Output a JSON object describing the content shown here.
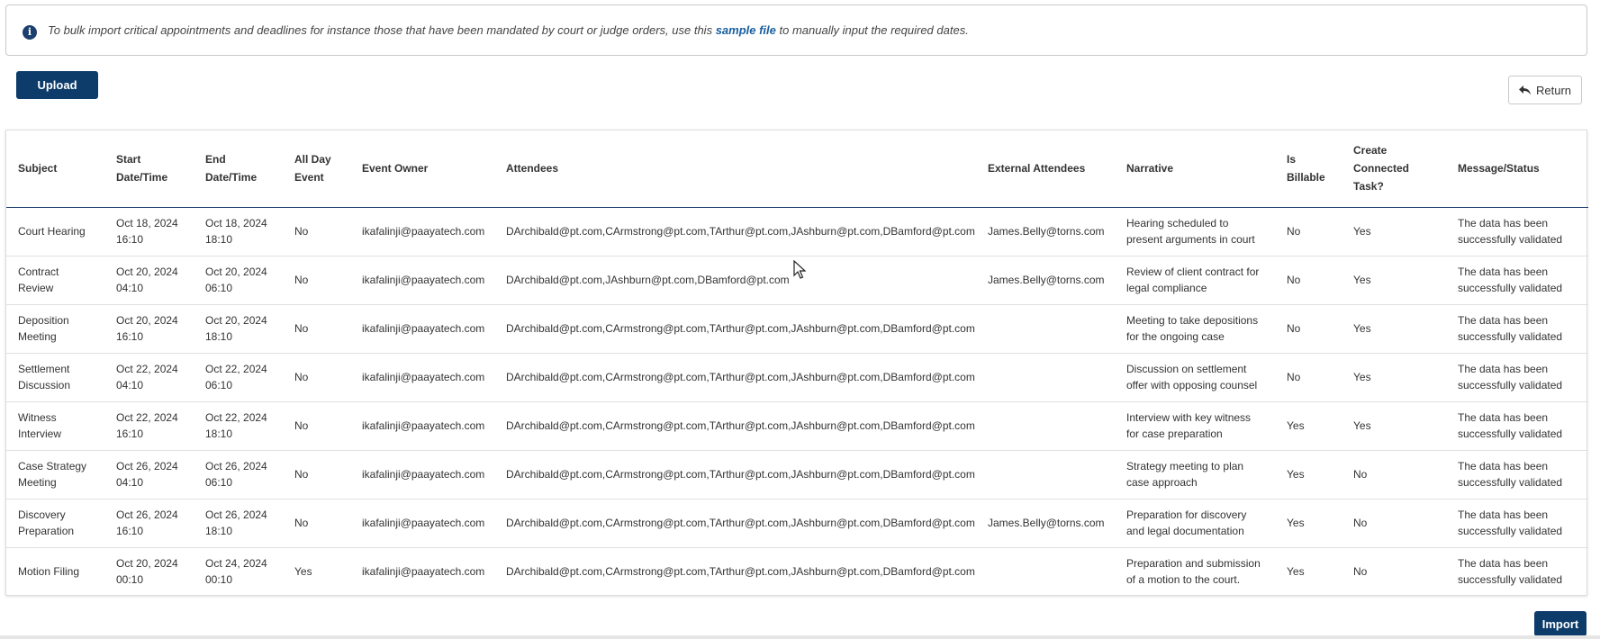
{
  "info": {
    "text_before": "To bulk import critical appointments and deadlines for instance those that have been mandated by court or judge orders, use this ",
    "link": "sample file",
    "text_after": " to manually input the required dates.",
    "icon": "info-icon"
  },
  "toolbar": {
    "upload_label": "Upload",
    "return_label": "Return",
    "return_icon": "reply-arrow-icon",
    "import_label": "Import"
  },
  "colors": {
    "primary": "#0d3c6b",
    "link": "#1a5fa0"
  },
  "table": {
    "headers": [
      [
        "Subject"
      ],
      [
        "Start",
        "Date/Time"
      ],
      [
        "End",
        "Date/Time"
      ],
      [
        "All Day",
        "Event"
      ],
      [
        "Event Owner"
      ],
      [
        "Attendees"
      ],
      [
        "External Attendees"
      ],
      [
        "Narrative"
      ],
      [
        "Is",
        "Billable"
      ],
      [
        "Create",
        "Connected",
        "Task?"
      ],
      [
        "Message/Status"
      ]
    ],
    "rows": [
      {
        "subject": [
          "Court Hearing"
        ],
        "start": [
          "Oct 18, 2024",
          "16:10"
        ],
        "end": [
          "Oct 18, 2024",
          "18:10"
        ],
        "all_day": "No",
        "owner": "ikafalinji@paayatech.com",
        "attendees": "DArchibald@pt.com,CArmstrong@pt.com,TArthur@pt.com,JAshburn@pt.com,DBamford@pt.com",
        "external": "James.Belly@torns.com",
        "narrative": [
          "Hearing scheduled to",
          "present arguments in court"
        ],
        "billable": "No",
        "task": "Yes",
        "status": [
          "The data has been",
          "successfully validated"
        ]
      },
      {
        "subject": [
          "Contract",
          "Review"
        ],
        "start": [
          "Oct 20, 2024",
          "04:10"
        ],
        "end": [
          "Oct 20, 2024",
          "06:10"
        ],
        "all_day": "No",
        "owner": "ikafalinji@paayatech.com",
        "attendees": "DArchibald@pt.com,JAshburn@pt.com,DBamford@pt.com",
        "external": "James.Belly@torns.com",
        "narrative": [
          "Review of client contract for",
          "legal compliance"
        ],
        "billable": "No",
        "task": "Yes",
        "status": [
          "The data has been",
          "successfully validated"
        ]
      },
      {
        "subject": [
          "Deposition",
          "Meeting"
        ],
        "start": [
          "Oct 20, 2024",
          "16:10"
        ],
        "end": [
          "Oct 20, 2024",
          "18:10"
        ],
        "all_day": "No",
        "owner": "ikafalinji@paayatech.com",
        "attendees": "DArchibald@pt.com,CArmstrong@pt.com,TArthur@pt.com,JAshburn@pt.com,DBamford@pt.com",
        "external": "",
        "narrative": [
          "Meeting to take depositions",
          "for the ongoing case"
        ],
        "billable": "No",
        "task": "Yes",
        "status": [
          "The data has been",
          "successfully validated"
        ]
      },
      {
        "subject": [
          "Settlement",
          "Discussion"
        ],
        "start": [
          "Oct 22, 2024",
          "04:10"
        ],
        "end": [
          "Oct 22, 2024",
          "06:10"
        ],
        "all_day": "No",
        "owner": "ikafalinji@paayatech.com",
        "attendees": "DArchibald@pt.com,CArmstrong@pt.com,TArthur@pt.com,JAshburn@pt.com,DBamford@pt.com",
        "external": "",
        "narrative": [
          "Discussion on settlement",
          "offer with opposing counsel"
        ],
        "billable": "No",
        "task": "Yes",
        "status": [
          "The data has been",
          "successfully validated"
        ]
      },
      {
        "subject": [
          "Witness",
          "Interview"
        ],
        "start": [
          "Oct 22, 2024",
          "16:10"
        ],
        "end": [
          "Oct 22, 2024",
          "18:10"
        ],
        "all_day": "No",
        "owner": "ikafalinji@paayatech.com",
        "attendees": "DArchibald@pt.com,CArmstrong@pt.com,TArthur@pt.com,JAshburn@pt.com,DBamford@pt.com",
        "external": "",
        "narrative": [
          "Interview with key witness",
          "for case preparation"
        ],
        "billable": "Yes",
        "task": "Yes",
        "status": [
          "The data has been",
          "successfully validated"
        ]
      },
      {
        "subject": [
          "Case Strategy",
          "Meeting"
        ],
        "start": [
          "Oct 26, 2024",
          "04:10"
        ],
        "end": [
          "Oct 26, 2024",
          "06:10"
        ],
        "all_day": "No",
        "owner": "ikafalinji@paayatech.com",
        "attendees": "DArchibald@pt.com,CArmstrong@pt.com,TArthur@pt.com,JAshburn@pt.com,DBamford@pt.com",
        "external": "",
        "narrative": [
          "Strategy meeting to plan",
          "case approach"
        ],
        "billable": "Yes",
        "task": "No",
        "status": [
          "The data has been",
          "successfully validated"
        ]
      },
      {
        "subject": [
          "Discovery",
          "Preparation"
        ],
        "start": [
          "Oct 26, 2024",
          "16:10"
        ],
        "end": [
          "Oct 26, 2024",
          "18:10"
        ],
        "all_day": "No",
        "owner": "ikafalinji@paayatech.com",
        "attendees": "DArchibald@pt.com,CArmstrong@pt.com,TArthur@pt.com,JAshburn@pt.com,DBamford@pt.com",
        "external": "James.Belly@torns.com",
        "narrative": [
          "Preparation for discovery",
          "and legal documentation"
        ],
        "billable": "Yes",
        "task": "No",
        "status": [
          "The data has been",
          "successfully validated"
        ]
      },
      {
        "subject": [
          "Motion Filing"
        ],
        "start": [
          "Oct 20, 2024",
          "00:10"
        ],
        "end": [
          "Oct 24, 2024",
          "00:10"
        ],
        "all_day": "Yes",
        "owner": "ikafalinji@paayatech.com",
        "attendees": "DArchibald@pt.com,CArmstrong@pt.com,TArthur@pt.com,JAshburn@pt.com,DBamford@pt.com",
        "external": "",
        "narrative": [
          "Preparation and submission",
          "of a motion to the court."
        ],
        "billable": "Yes",
        "task": "No",
        "status": [
          "The data has been",
          "successfully validated"
        ]
      }
    ]
  }
}
